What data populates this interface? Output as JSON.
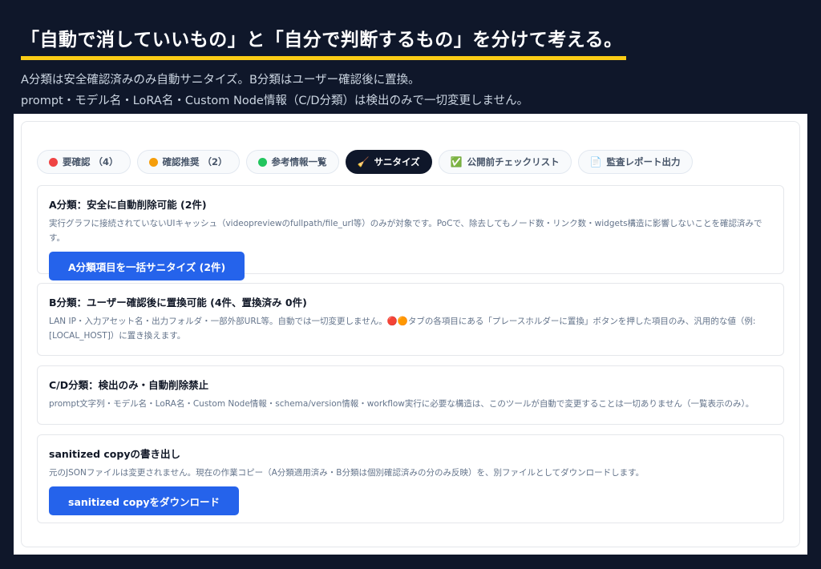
{
  "hero": {
    "title": "「自動で消していいもの」と「自分で判断するもの」を分けて考える。",
    "subtitle_1": "A分類は安全確認済みのみ自動サニタイズ。B分類はユーザー確認後に置換。",
    "subtitle_2": "prompt・モデル名・LoRA名・Custom Node情報（C/D分類）は検出のみで一切変更しません。"
  },
  "tabs": [
    {
      "label": "要確認 （4）",
      "icon": "red-dot",
      "color": "#ef4444"
    },
    {
      "label": "確認推奨 （2）",
      "icon": "orange-dot",
      "color": "#f59e0b"
    },
    {
      "label": "参考情報一覧",
      "icon": "green-dot",
      "color": "#22c55e"
    },
    {
      "label": "サニタイズ",
      "icon": "broom-icon",
      "glyph": "🧹",
      "active": true
    },
    {
      "label": "公開前チェックリスト",
      "icon": "check-mark-icon",
      "glyph": "✅"
    },
    {
      "label": "監査レポート出力",
      "icon": "document-icon",
      "glyph": "📄"
    }
  ],
  "cards": {
    "a": {
      "title": "A分類：安全に自動削除可能 (2件)",
      "desc": "実行グラフに接続されていないUIキャッシュ（videopreviewのfullpath/file_url等）のみが対象です。PoCで、除去してもノード数・リンク数・widgets構造に影響しないことを確認済みです。",
      "button": "A分類項目を一括サニタイズ (2件)"
    },
    "b": {
      "title": "B分類：ユーザー確認後に置換可能 (4件、置換済み 0件)",
      "desc": "LAN IP・入力アセット名・出力フォルダ・一部外部URL等。自動では一切変更しません。🔴🟠タブの各項目にある「プレースホルダーに置換」ボタンを押した項目のみ、汎用的な値（例: [LOCAL_HOST]）に置き換えます。"
    },
    "cd": {
      "title": "C/D分類：検出のみ・自動削除禁止",
      "desc": "prompt文字列・モデル名・LoRA名・Custom Node情報・schema/version情報・workflow実行に必要な構造は、このツールが自動で変更することは一切ありません（一覧表示のみ）。"
    },
    "copy": {
      "title": "sanitized copyの書き出し",
      "desc": "元のJSONファイルは変更されません。現在の作業コピー（A分類適用済み・B分類は個別確認済みの分のみ反映）を、別ファイルとしてダウンロードします。",
      "button": "sanitized copyをダウンロード"
    }
  },
  "colors": {
    "background": "#0f172a",
    "accent_underline": "#facc15",
    "primary_button": "#2563eb"
  }
}
